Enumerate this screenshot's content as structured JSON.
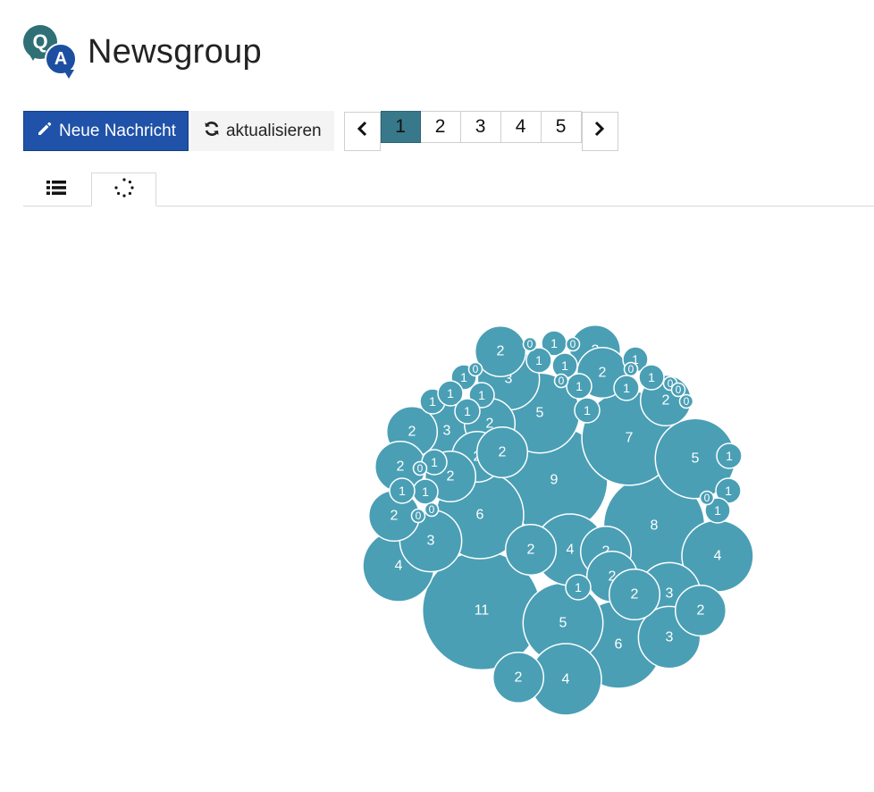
{
  "header": {
    "logo_q": "Q",
    "logo_a": "A",
    "title": "Newsgroup"
  },
  "toolbar": {
    "new_label": "Neue Nachricht",
    "new_icon": "pencil-icon",
    "refresh_label": "aktualisieren",
    "refresh_icon": "refresh-icon"
  },
  "pagination": {
    "prev_icon": "chevron-left-icon",
    "next_icon": "chevron-right-icon",
    "pages": [
      "1",
      "2",
      "3",
      "4",
      "5"
    ],
    "active_page": "1"
  },
  "tabs": [
    {
      "icon": "list-icon",
      "active": false
    },
    {
      "icon": "bubbles-icon",
      "active": true
    }
  ],
  "colors": {
    "bubble": "#4a9fb5",
    "primary": "#1f52a8",
    "active_page": "#37798a"
  },
  "chart_data": {
    "type": "bubble-pack",
    "title": "",
    "values": [
      11,
      9,
      8,
      7,
      6,
      6,
      5,
      5,
      5,
      4,
      4,
      4,
      4,
      3,
      3,
      3,
      3,
      3,
      2,
      2,
      2,
      2,
      2,
      2,
      2,
      2,
      2,
      2,
      2,
      2,
      2,
      2,
      2,
      2,
      2,
      1,
      1,
      1,
      1,
      1,
      1,
      1,
      1,
      1,
      1,
      1,
      1,
      1,
      1,
      1,
      1,
      1,
      1,
      1,
      1,
      0,
      0,
      0,
      0,
      0,
      0,
      0,
      0,
      0,
      0,
      0,
      0
    ]
  }
}
